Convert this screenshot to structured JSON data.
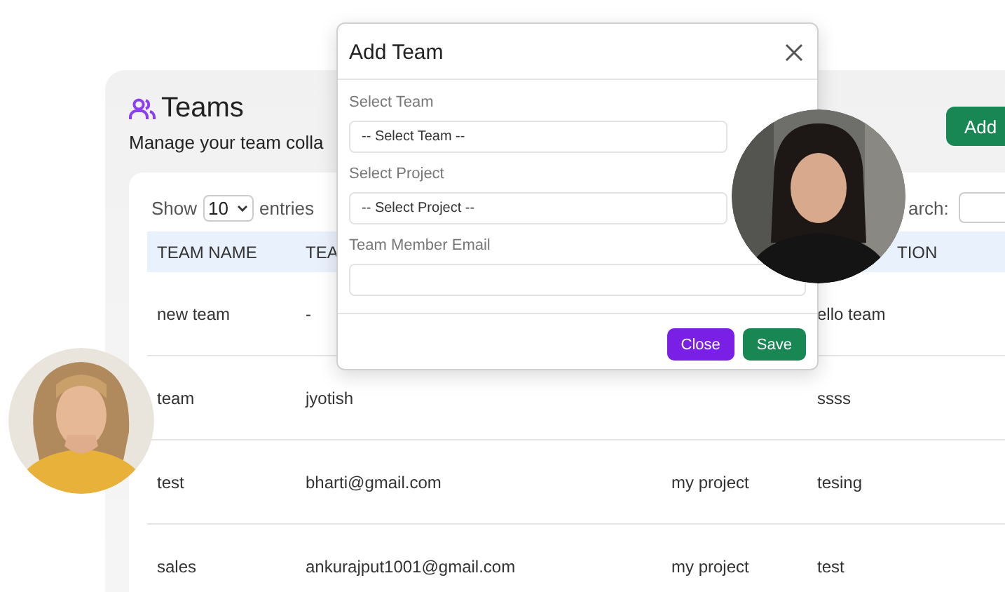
{
  "page": {
    "title": "Teams",
    "subtitle": "Manage your team colla",
    "add_button": "Add"
  },
  "table_controls": {
    "show_label": "Show",
    "page_size": "10",
    "entries_label": "entries",
    "search_label": "arch:"
  },
  "table": {
    "columns": [
      {
        "label": "TEAM NAME"
      },
      {
        "label": "TEA"
      },
      {},
      {
        "label": "TION"
      }
    ],
    "rows": [
      {
        "cells": [
          "new team",
          "-",
          null,
          "ello team"
        ]
      },
      {
        "cells": [
          "team",
          "jyotish",
          null,
          "ssss"
        ]
      },
      {
        "cells": [
          "test",
          "bharti@gmail.com",
          "my project",
          "tesing"
        ]
      },
      {
        "cells": [
          "sales",
          "ankurajput1001@gmail.com",
          "my project",
          "test"
        ]
      }
    ]
  },
  "dialog": {
    "title": "Add Team",
    "fields": [
      {
        "kind": "select",
        "label": "Select Team",
        "value": "-- Select Team --"
      },
      {
        "kind": "select",
        "label": "Select Project",
        "value": "-- Select Project --"
      },
      {
        "kind": "input",
        "label": "Team Member Email"
      }
    ],
    "buttons": [
      {
        "label": "Close",
        "kind": "secondary"
      },
      {
        "label": "Save",
        "kind": "primary"
      }
    ]
  }
}
